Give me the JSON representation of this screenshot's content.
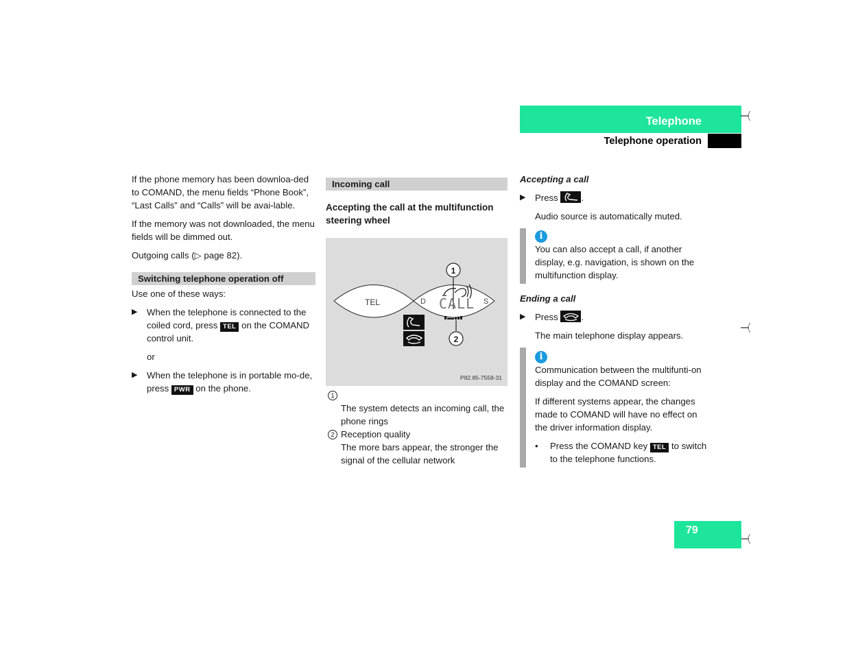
{
  "header": {
    "chapter": "Telephone",
    "section": "Telephone operation",
    "page_number": "79",
    "accent_color": "#1de59b"
  },
  "col1": {
    "intro_p1": "If the phone memory has been downloa-ded to COMAND, the menu fields “Phone Book”, “Last Calls” and “Calls” will be avai-lable.",
    "intro_p2": "If the memory was not downloaded, the menu fields will be dimmed out.",
    "intro_p3": "Outgoing calls (▷ page 82).",
    "section_title": "Switching telephone operation off",
    "use_ways": "Use one of these ways:",
    "step1_pre": "When the telephone is connected to the coiled cord, press ",
    "step1_key": "TEL",
    "step1_post": " on the COMAND control unit.",
    "or": "or",
    "step2_pre": "When the telephone is in portable mo-de, press ",
    "step2_key": "PWR",
    "step2_post": " on the phone."
  },
  "col2": {
    "section_title": "Incoming call",
    "subhead": "Accepting the call at the multifunction steering wheel",
    "figure": {
      "left_label": "TEL",
      "right_left_letter": "D",
      "right_right_letter": "S",
      "display_text": "CALL",
      "callout1": "1",
      "callout2": "2",
      "code": "P82.85-7558-31"
    },
    "legend": [
      {
        "num": "1",
        "lines": [
          "The system detects an incoming call, the phone rings"
        ]
      },
      {
        "num": "2",
        "lines": [
          "Reception quality",
          "The more bars appear, the stronger the signal of the cellular network"
        ]
      }
    ]
  },
  "col3": {
    "accept_head": "Accepting a call",
    "accept_press": "Press ",
    "accept_after": ".",
    "accept_note": "Audio source is automatically muted.",
    "info1_icon": "i",
    "info1_text": "You can also accept a call, if another display, e.g. navigation, is shown on the multifunction display.",
    "end_head": "Ending a call",
    "end_press": "Press ",
    "end_after": ".",
    "end_note": "The main telephone display appears.",
    "info2_icon": "i",
    "info2_p1": "Communication between the multifunti-on display and the COMAND screen:",
    "info2_p2": "If different systems appear, the changes made to COMAND will have no effect on the driver information display.",
    "info2_bullet_pre": "Press the COMAND key ",
    "info2_bullet_key": "TEL",
    "info2_bullet_post": " to switch to the telephone functions.",
    "info_color": "#1b9bdf"
  }
}
